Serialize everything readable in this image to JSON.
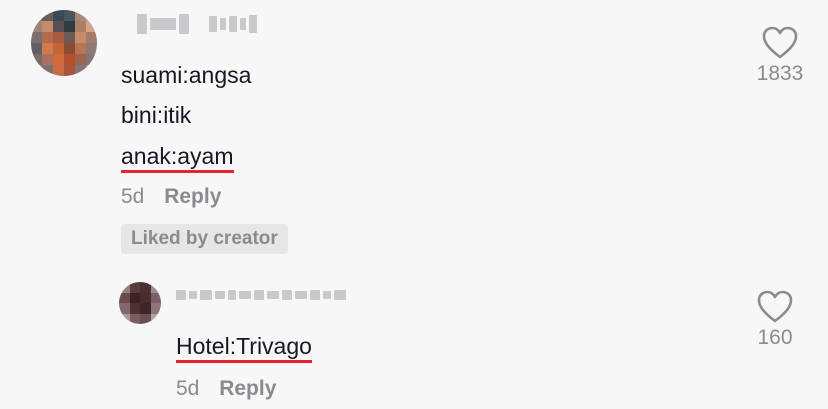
{
  "comment": {
    "lines": [
      "suami:angsa",
      "bini:itik",
      "anak:ayam"
    ],
    "date": "5d",
    "reply_label": "Reply",
    "badge": "Liked by creator",
    "like_count": "1833",
    "like_icon": "heart-outline-icon"
  },
  "reply": {
    "text": "Hotel:Trivago",
    "date": "5d",
    "reply_label": "Reply",
    "like_count": "160",
    "like_icon": "heart-outline-icon"
  },
  "colors": {
    "accent_underline": "#e8232e",
    "muted": "#8a8b91",
    "background": "#f7f7f7"
  }
}
